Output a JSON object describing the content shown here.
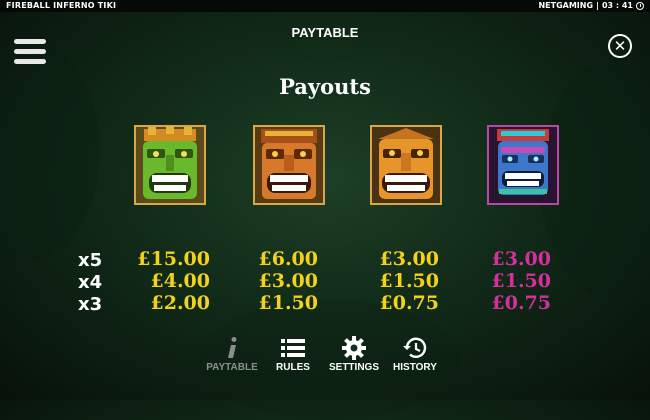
{
  "topbar": {
    "game_title": "FIREBALL INFERNO TIKI",
    "provider": "NETGAMING",
    "separator": "|",
    "time": "03 : 41"
  },
  "header": {
    "title": "PAYTABLE",
    "menu_icon": "hamburger-menu-icon",
    "close_icon": "close-icon",
    "close_glyph": "✕"
  },
  "section_title": "Payouts",
  "symbols": [
    {
      "name": "green-tiki-mask",
      "frame_color": "#d9a648",
      "mask_color": "#6ab82c"
    },
    {
      "name": "orange-tiki-mask",
      "frame_color": "#d9a648",
      "mask_color": "#d6792b"
    },
    {
      "name": "yellow-tiki-mask",
      "frame_color": "#d9a648",
      "mask_color": "#e5952a"
    },
    {
      "name": "blue-tiki-mask",
      "frame_color": "#b54aa6",
      "mask_color": "#3b78c9"
    }
  ],
  "multipliers": [
    "x5",
    "x4",
    "x3"
  ],
  "payouts": [
    [
      "£15.00",
      "£4.00",
      "£2.00"
    ],
    [
      "£6.00",
      "£3.00",
      "£1.50"
    ],
    [
      "£3.00",
      "£1.50",
      "£0.75"
    ],
    [
      "£3.00",
      "£1.50",
      "£0.75"
    ]
  ],
  "payout_colors": [
    "#f2d21b",
    "#f2d21b",
    "#f2d21b",
    "#d52f9b"
  ],
  "bottom_nav": [
    {
      "label": "PAYTABLE",
      "icon": "info-icon",
      "active": true
    },
    {
      "label": "RULES",
      "icon": "list-icon",
      "active": false
    },
    {
      "label": "SETTINGS",
      "icon": "gear-icon",
      "active": false
    },
    {
      "label": "HISTORY",
      "icon": "history-icon",
      "active": false
    }
  ]
}
